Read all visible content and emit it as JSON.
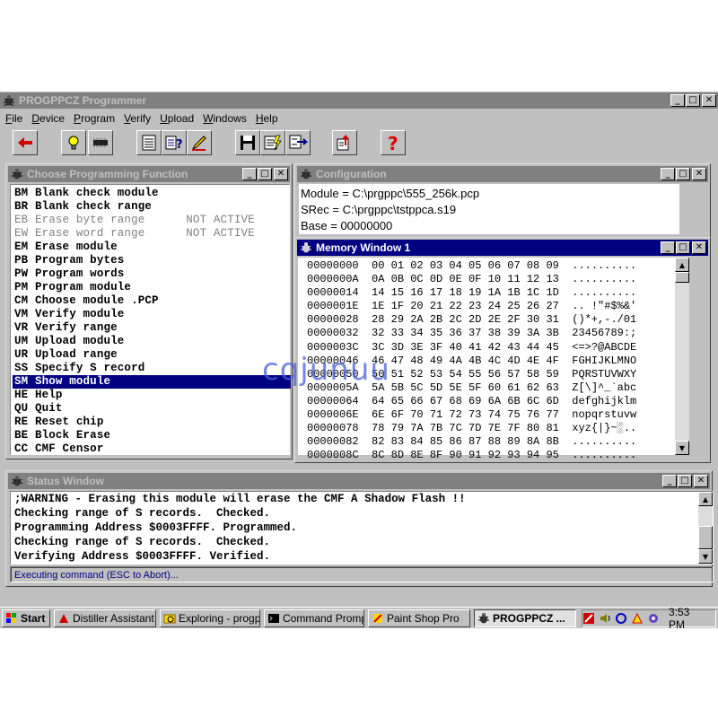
{
  "app": {
    "title": "PROGPPCZ Programmer"
  },
  "menu": [
    "File",
    "Device",
    "Program",
    "Verify",
    "Upload",
    "Windows",
    "Help"
  ],
  "toolbar": {
    "icons": [
      "back-arrow-icon",
      "lightbulb-icon",
      "chip-icon",
      "calculator-icon",
      "help-query-icon",
      "pen-icon",
      "floppy-save-icon",
      "program-flash-icon",
      "swap-icon",
      "upload-icon",
      "question-mark-icon"
    ]
  },
  "func_window": {
    "title": "Choose Programming Function",
    "items": [
      {
        "code": "BM",
        "label": "Blank check module",
        "status": ""
      },
      {
        "code": "BR",
        "label": "Blank check range",
        "status": ""
      },
      {
        "code": "EB",
        "label": "Erase byte range",
        "status": "NOT ACTIVE"
      },
      {
        "code": "EW",
        "label": "Erase word range",
        "status": "NOT ACTIVE"
      },
      {
        "code": "EM",
        "label": "Erase module",
        "status": ""
      },
      {
        "code": "PB",
        "label": "Program bytes",
        "status": ""
      },
      {
        "code": "PW",
        "label": "Program words",
        "status": ""
      },
      {
        "code": "PM",
        "label": "Program module",
        "status": ""
      },
      {
        "code": "CM",
        "label": "Choose module .PCP",
        "status": ""
      },
      {
        "code": "VM",
        "label": "Verify module",
        "status": ""
      },
      {
        "code": "VR",
        "label": "Verify range",
        "status": ""
      },
      {
        "code": "UM",
        "label": "Upload module",
        "status": ""
      },
      {
        "code": "UR",
        "label": "Upload range",
        "status": ""
      },
      {
        "code": "SS",
        "label": "Specify S record",
        "status": ""
      },
      {
        "code": "SM",
        "label": "Show module",
        "status": ""
      },
      {
        "code": "HE",
        "label": "Help",
        "status": ""
      },
      {
        "code": "QU",
        "label": "Quit",
        "status": ""
      },
      {
        "code": "RE",
        "label": "Reset chip",
        "status": ""
      },
      {
        "code": "BE",
        "label": "Block Erase",
        "status": ""
      },
      {
        "code": "CC",
        "label": "CMF Censor",
        "status": ""
      }
    ],
    "selected_index": 14
  },
  "config_window": {
    "title": "Configuration",
    "module": "Module = C:\\prgppc\\555_256k.pcp",
    "srec": "SRec = C:\\prgppc\\tstppca.s19",
    "base": "Base = 00000000"
  },
  "memory_window": {
    "title": "Memory Window 1",
    "rows": [
      {
        "addr": "00000000",
        "bytes": "00 01 02 03 04 05 06 07 08 09",
        "ascii": ".........."
      },
      {
        "addr": "0000000A",
        "bytes": "0A 0B 0C 0D 0E 0F 10 11 12 13",
        "ascii": ".........."
      },
      {
        "addr": "00000014",
        "bytes": "14 15 16 17 18 19 1A 1B 1C 1D",
        "ascii": ".........."
      },
      {
        "addr": "0000001E",
        "bytes": "1E 1F 20 21 22 23 24 25 26 27",
        "ascii": ".. !\"#$%&'"
      },
      {
        "addr": "00000028",
        "bytes": "28 29 2A 2B 2C 2D 2E 2F 30 31",
        "ascii": "()*+,-./01"
      },
      {
        "addr": "00000032",
        "bytes": "32 33 34 35 36 37 38 39 3A 3B",
        "ascii": "23456789:;"
      },
      {
        "addr": "0000003C",
        "bytes": "3C 3D 3E 3F 40 41 42 43 44 45",
        "ascii": "<=>?@ABCDE"
      },
      {
        "addr": "00000046",
        "bytes": "46 47 48 49 4A 4B 4C 4D 4E 4F",
        "ascii": "FGHIJKLMNO"
      },
      {
        "addr": "00000050",
        "bytes": "50 51 52 53 54 55 56 57 58 59",
        "ascii": "PQRSTUVWXY"
      },
      {
        "addr": "0000005A",
        "bytes": "5A 5B 5C 5D 5E 5F 60 61 62 63",
        "ascii": "Z[\\]^_`abc"
      },
      {
        "addr": "00000064",
        "bytes": "64 65 66 67 68 69 6A 6B 6C 6D",
        "ascii": "defghijklm"
      },
      {
        "addr": "0000006E",
        "bytes": "6E 6F 70 71 72 73 74 75 76 77",
        "ascii": "nopqrstuvw"
      },
      {
        "addr": "00000078",
        "bytes": "78 79 7A 7B 7C 7D 7E 7F 80 81",
        "ascii": "xyz{|}~░.."
      },
      {
        "addr": "00000082",
        "bytes": "82 83 84 85 86 87 88 89 8A 8B",
        "ascii": ".........."
      },
      {
        "addr": "0000008C",
        "bytes": "8C 8D 8E 8F 90 91 92 93 94 95",
        "ascii": ".........."
      }
    ]
  },
  "status_window": {
    "title": "Status Window",
    "lines": [
      ";WARNING - Erasing this module will erase the CMF A Shadow Flash !!",
      "Checking range of S records.  Checked.",
      "Programming Address $0003FFFF. Programmed.",
      "Checking range of S records.  Checked.",
      "Verifying Address $0003FFFF. Verified."
    ],
    "executing": "Executing command (ESC to Abort)..."
  },
  "taskbar": {
    "start": "Start",
    "tasks": [
      "Distiller Assistant ...",
      "Exploring - progp...",
      "Command Prompt",
      "Paint Shop Pro",
      "PROGPPCZ ..."
    ],
    "clock": "3:53 PM"
  },
  "watermark": "cqjunuu"
}
